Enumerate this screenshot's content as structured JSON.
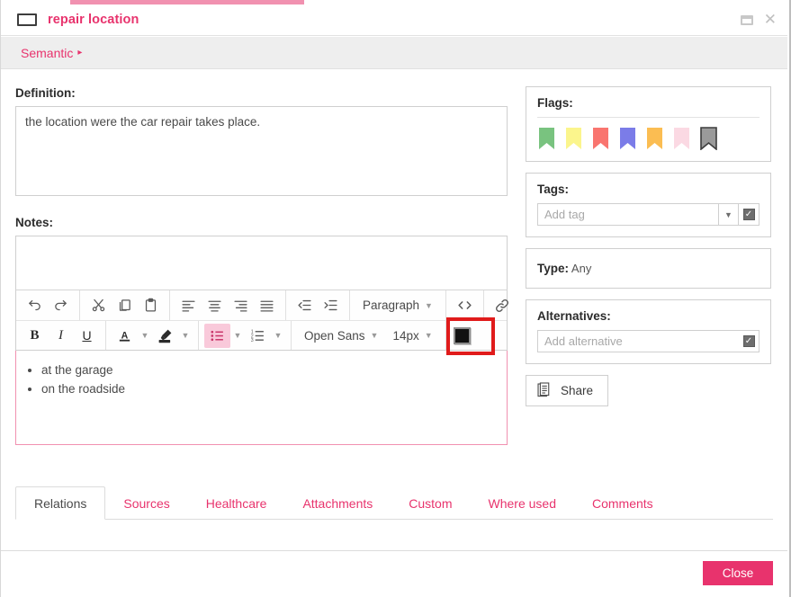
{
  "window": {
    "title": "repair location",
    "restore_icon": "restore-window-icon",
    "close_icon": "close-window-icon"
  },
  "breadcrumb": {
    "items": [
      "Semantic"
    ],
    "arrow": "▸"
  },
  "definition": {
    "label": "Definition:",
    "value": "the location were the car repair takes place."
  },
  "notes": {
    "label": "Notes:",
    "value": ""
  },
  "editor": {
    "toolbar_row1": [
      {
        "name": "undo-button",
        "icon": "undo-icon",
        "title": "Undo"
      },
      {
        "name": "redo-button",
        "icon": "redo-icon",
        "title": "Redo"
      },
      {
        "name": "cut-button",
        "icon": "scissors-icon",
        "title": "Cut"
      },
      {
        "name": "copy-button",
        "icon": "copy-icon",
        "title": "Copy"
      },
      {
        "name": "paste-button",
        "icon": "clipboard-icon",
        "title": "Paste"
      },
      {
        "name": "align-left-button",
        "icon": "align-left-icon",
        "title": "Align left"
      },
      {
        "name": "align-center-button",
        "icon": "align-center-icon",
        "title": "Align center"
      },
      {
        "name": "align-right-button",
        "icon": "align-right-icon",
        "title": "Align right"
      },
      {
        "name": "align-justify-button",
        "icon": "align-justify-icon",
        "title": "Justify"
      },
      {
        "name": "outdent-button",
        "icon": "outdent-icon",
        "title": "Decrease indent"
      },
      {
        "name": "indent-button",
        "icon": "indent-icon",
        "title": "Increase indent"
      }
    ],
    "paragraph_style": "Paragraph",
    "source_code_label": "<>",
    "toolbar_row2": [
      {
        "name": "bold-button",
        "icon": "bold-icon",
        "label": "B"
      },
      {
        "name": "italic-button",
        "icon": "italic-icon",
        "label": "I"
      },
      {
        "name": "underline-button",
        "icon": "underline-icon",
        "label": "U"
      }
    ],
    "font_family": "Open Sans",
    "font_size": "14px",
    "content_list": [
      "at the garage",
      "on the roadside"
    ],
    "active_button": "bulleted-list-button",
    "annotated_button": "show-blocks-button"
  },
  "flags": {
    "label": "Flags:",
    "colors": [
      "#79c37f",
      "#fbf58c",
      "#f9756f",
      "#7b7ce8",
      "#fbbd52",
      "#fbd9e3",
      "#9a9a9a"
    ],
    "names": [
      "flag-green",
      "flag-yellow",
      "flag-red",
      "flag-blue",
      "flag-orange",
      "flag-pink",
      "flag-gray"
    ]
  },
  "tags": {
    "label": "Tags:",
    "placeholder": "Add tag",
    "value": ""
  },
  "type": {
    "label": "Type:",
    "value": "Any"
  },
  "alternatives": {
    "label": "Alternatives:",
    "placeholder": "Add alternative",
    "value": ""
  },
  "share": {
    "label": "Share",
    "icon": "document-copy-icon"
  },
  "tabs": {
    "items": [
      "Relations",
      "Sources",
      "Healthcare",
      "Attachments",
      "Custom",
      "Where used",
      "Comments"
    ],
    "active": "Relations"
  },
  "footer": {
    "close_label": "Close",
    "close_color": "#e8336d"
  }
}
